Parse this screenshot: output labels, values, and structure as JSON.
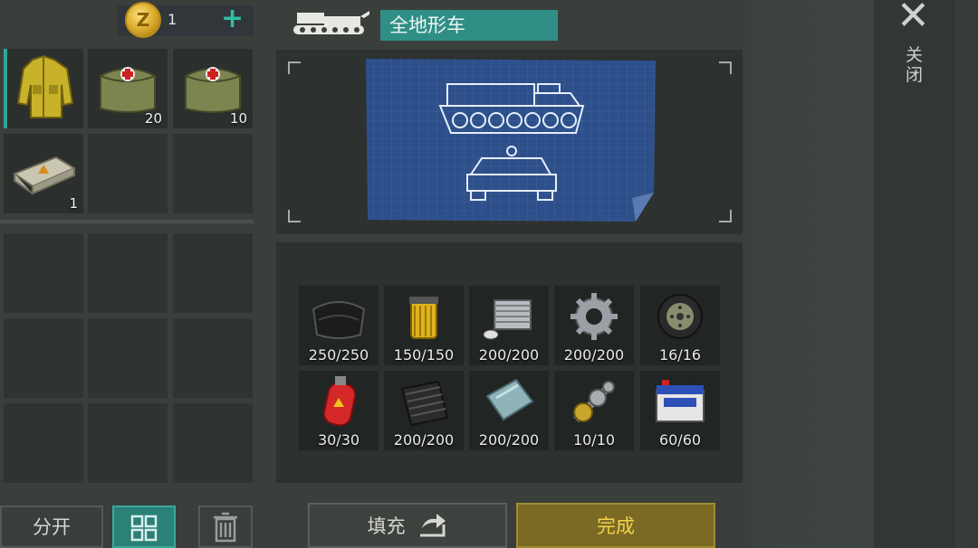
{
  "currency": {
    "count": "1"
  },
  "header": {
    "title": "全地形车"
  },
  "inventory": {
    "slots": [
      {
        "icon": "yellow-jacket-icon",
        "count": ""
      },
      {
        "icon": "medkit-bag-icon",
        "count": "20"
      },
      {
        "icon": "medkit-bag-icon",
        "count": "10"
      },
      {
        "icon": "explosive-brick-icon",
        "count": "1"
      }
    ]
  },
  "materials": [
    {
      "icon": "leather-icon",
      "qty": "250/250"
    },
    {
      "icon": "oil-filter-icon",
      "qty": "150/150"
    },
    {
      "icon": "engine-cylinder-icon",
      "qty": "200/200"
    },
    {
      "icon": "gear-icon",
      "qty": "200/200"
    },
    {
      "icon": "wheel-icon",
      "qty": "16/16"
    },
    {
      "icon": "gas-cylinder-icon",
      "qty": "30/30"
    },
    {
      "icon": "rubber-track-icon",
      "qty": "200/200"
    },
    {
      "icon": "metal-sheet-icon",
      "qty": "200/200"
    },
    {
      "icon": "transmission-shaft-icon",
      "qty": "10/10"
    },
    {
      "icon": "battery-icon",
      "qty": "60/60"
    }
  ],
  "buttons": {
    "split": "分开",
    "fill": "填充",
    "done": "完成",
    "close": "关闭"
  },
  "colors": {
    "accent_teal": "#2f8f86",
    "done_gold": "#f3d24a"
  }
}
